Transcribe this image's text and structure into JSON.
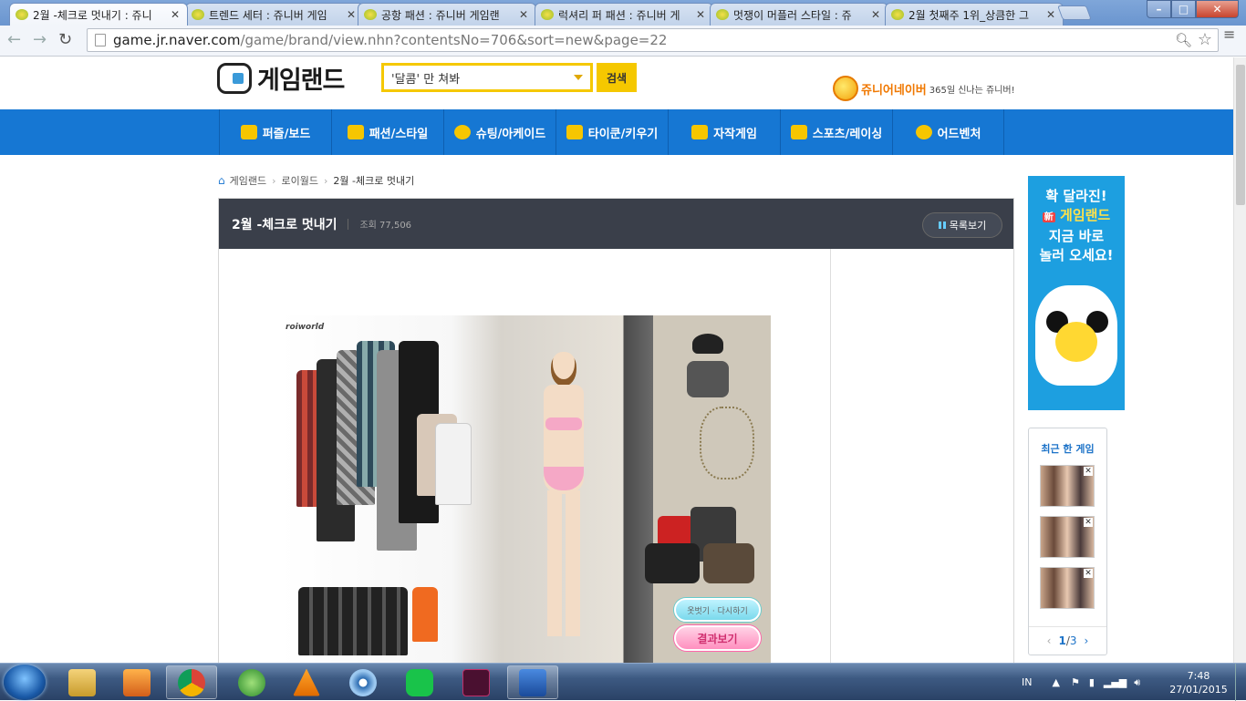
{
  "browser": {
    "tabs": [
      {
        "title": "2월 -체크로 멋내기 : 쥬니"
      },
      {
        "title": "트렌드 세터 : 쥬니버 게임"
      },
      {
        "title": "공항 패션 : 쥬니버 게임랜"
      },
      {
        "title": "럭셔리 퍼 패션 : 쥬니버 게"
      },
      {
        "title": "멋쟁이 머플러 스타일 : 쥬"
      },
      {
        "title": "2월 첫째주 1위_상큼한 그"
      }
    ],
    "url_host": "game.jr.naver.com",
    "url_path": "/game/brand/view.nhn?contentsNo=706&sort=new&page=22"
  },
  "header": {
    "logo_text": "게임랜드",
    "search_value": "'달콤' 만 쳐봐",
    "search_button": "검색",
    "jr_brand": "쥬니어네이버",
    "jr_tagline": "365일 신나는 쥬니버!"
  },
  "gnb": {
    "items": [
      {
        "label": "퍼즐/보드"
      },
      {
        "label": "패션/스타일"
      },
      {
        "label": "슈팅/아케이드"
      },
      {
        "label": "타이쿤/키우기"
      },
      {
        "label": "자작게임"
      },
      {
        "label": "스포츠/레이싱"
      },
      {
        "label": "어드벤처"
      }
    ]
  },
  "breadcrumb": {
    "items": [
      "게임랜드",
      "로이월드",
      "2월 -체크로 멋내기"
    ]
  },
  "game": {
    "title": "2월 -체크로 멋내기",
    "views_label": "조회 77,506",
    "list_button": "목록보기",
    "flash_logo": "roiworld",
    "reset_button": "옷벗기 · 다시하기",
    "result_button": "결과보기"
  },
  "banner": {
    "line1": "확 달라진!",
    "badge": "新",
    "line2": "게임랜드",
    "line3": "지금 바로",
    "line4": "놀러 오세요!"
  },
  "recent": {
    "title": "최근 한 게임",
    "page_current": "1",
    "page_total": "3"
  },
  "taskbar": {
    "lang": "IN",
    "time": "7:48",
    "date": "27/01/2015"
  }
}
